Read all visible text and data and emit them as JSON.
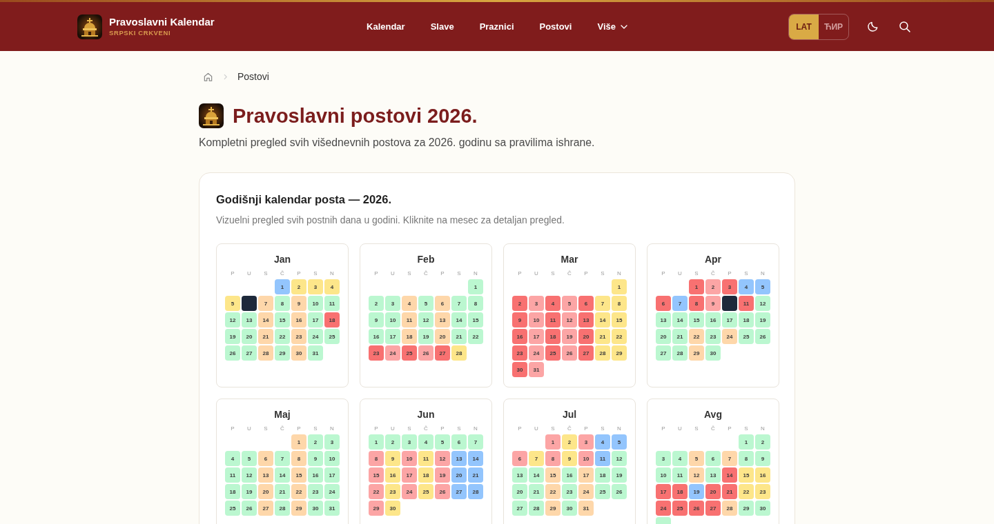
{
  "header": {
    "brand": {
      "title": "Pravoslavni Kalendar",
      "subtitle": "SRPSKI CRKVENI"
    },
    "nav": [
      {
        "label": "Kalendar",
        "kind": "link"
      },
      {
        "label": "Slave",
        "kind": "link"
      },
      {
        "label": "Praznici",
        "kind": "link"
      },
      {
        "label": "Postovi",
        "kind": "link"
      },
      {
        "label": "Više",
        "kind": "menu"
      }
    ],
    "language_toggle": [
      {
        "label": "LAT",
        "selected": true
      },
      {
        "label": "ЋИР",
        "selected": false
      }
    ]
  },
  "breadcrumb": {
    "current": "Postovi"
  },
  "page": {
    "title": "Pravoslavni postovi 2026.",
    "description": "Kompletni pregled svih višednevnih postova za 2026. godinu sa pravilima ishrane."
  },
  "calendar": {
    "title": "Godišnji kalendar posta — 2026.",
    "description": "Vizuelni pregled svih postnih dana u godini. Kliknite na mesec za detaljan pregled.",
    "months": [
      {
        "name": "Jan",
        "weekdays": [
          "P",
          "U",
          "S",
          "Č",
          "P",
          "S",
          "N"
        ],
        "cells": [
          {
            "kind": "blank"
          },
          {
            "kind": "blank"
          },
          {
            "kind": "blank"
          },
          {
            "kind": "day",
            "number": "1",
            "color": "#93c5fd"
          },
          {
            "kind": "day",
            "number": "2",
            "color": "#fde68a"
          },
          {
            "kind": "day",
            "number": "3",
            "color": "#fde68a"
          },
          {
            "kind": "day",
            "number": "4",
            "color": "#fde68a"
          },
          {
            "kind": "day",
            "number": "5",
            "color": "#fde68a"
          },
          {
            "kind": "day",
            "color": "#1e293b"
          },
          {
            "kind": "day",
            "number": "7",
            "color": "#fed7aa"
          },
          {
            "kind": "day",
            "number": "8",
            "color": "#bbf7d0"
          },
          {
            "kind": "day",
            "number": "9",
            "color": "#fed7aa"
          },
          {
            "kind": "day",
            "number": "10",
            "color": "#bbf7d0"
          },
          {
            "kind": "day",
            "number": "11",
            "color": "#bbf7d0"
          },
          {
            "kind": "day",
            "number": "12",
            "color": "#bbf7d0"
          },
          {
            "kind": "day",
            "number": "13",
            "color": "#bbf7d0"
          },
          {
            "kind": "day",
            "number": "14",
            "color": "#fed7aa"
          },
          {
            "kind": "day",
            "number": "15",
            "color": "#bbf7d0"
          },
          {
            "kind": "day",
            "number": "16",
            "color": "#fed7aa"
          },
          {
            "kind": "day",
            "number": "17",
            "color": "#bbf7d0"
          },
          {
            "kind": "day",
            "number": "18",
            "color": "#f87171"
          },
          {
            "kind": "day",
            "number": "19",
            "color": "#bbf7d0"
          },
          {
            "kind": "day",
            "number": "20",
            "color": "#bbf7d0"
          },
          {
            "kind": "day",
            "number": "21",
            "color": "#fed7aa"
          },
          {
            "kind": "day",
            "number": "22",
            "color": "#bbf7d0"
          },
          {
            "kind": "day",
            "number": "23",
            "color": "#fed7aa"
          },
          {
            "kind": "day",
            "number": "24",
            "color": "#bbf7d0"
          },
          {
            "kind": "day",
            "number": "25",
            "color": "#bbf7d0"
          },
          {
            "kind": "day",
            "number": "26",
            "color": "#bbf7d0"
          },
          {
            "kind": "day",
            "number": "27",
            "color": "#bbf7d0"
          },
          {
            "kind": "day",
            "number": "28",
            "color": "#fed7aa"
          },
          {
            "kind": "day",
            "number": "29",
            "color": "#bbf7d0"
          },
          {
            "kind": "day",
            "number": "30",
            "color": "#fed7aa"
          },
          {
            "kind": "day",
            "number": "31",
            "color": "#bbf7d0"
          }
        ]
      },
      {
        "name": "Feb",
        "weekdays": [
          "P",
          "U",
          "S",
          "Č",
          "P",
          "S",
          "N"
        ],
        "cells": [
          {
            "kind": "blank"
          },
          {
            "kind": "blank"
          },
          {
            "kind": "blank"
          },
          {
            "kind": "blank"
          },
          {
            "kind": "blank"
          },
          {
            "kind": "blank"
          },
          {
            "kind": "day",
            "number": "1",
            "color": "#bbf7d0"
          },
          {
            "kind": "day",
            "number": "2",
            "color": "#bbf7d0"
          },
          {
            "kind": "day",
            "number": "3",
            "color": "#bbf7d0"
          },
          {
            "kind": "day",
            "number": "4",
            "color": "#fed7aa"
          },
          {
            "kind": "day",
            "number": "5",
            "color": "#bbf7d0"
          },
          {
            "kind": "day",
            "number": "6",
            "color": "#fed7aa"
          },
          {
            "kind": "day",
            "number": "7",
            "color": "#bbf7d0"
          },
          {
            "kind": "day",
            "number": "8",
            "color": "#bbf7d0"
          },
          {
            "kind": "day",
            "number": "9",
            "color": "#bbf7d0"
          },
          {
            "kind": "day",
            "number": "10",
            "color": "#bbf7d0"
          },
          {
            "kind": "day",
            "number": "11",
            "color": "#fed7aa"
          },
          {
            "kind": "day",
            "number": "12",
            "color": "#bbf7d0"
          },
          {
            "kind": "day",
            "number": "13",
            "color": "#fed7aa"
          },
          {
            "kind": "day",
            "number": "14",
            "color": "#bbf7d0"
          },
          {
            "kind": "day",
            "number": "15",
            "color": "#bbf7d0"
          },
          {
            "kind": "day",
            "number": "16",
            "color": "#bbf7d0"
          },
          {
            "kind": "day",
            "number": "17",
            "color": "#bbf7d0"
          },
          {
            "kind": "day",
            "number": "18",
            "color": "#fed7aa"
          },
          {
            "kind": "day",
            "number": "19",
            "color": "#bbf7d0"
          },
          {
            "kind": "day",
            "number": "20",
            "color": "#fed7aa"
          },
          {
            "kind": "day",
            "number": "21",
            "color": "#bbf7d0"
          },
          {
            "kind": "day",
            "number": "22",
            "color": "#bbf7d0"
          },
          {
            "kind": "day",
            "number": "23",
            "color": "#f87171"
          },
          {
            "kind": "day",
            "number": "24",
            "color": "#fca5a5"
          },
          {
            "kind": "day",
            "number": "25",
            "color": "#f87171"
          },
          {
            "kind": "day",
            "number": "26",
            "color": "#fca5a5"
          },
          {
            "kind": "day",
            "number": "27",
            "color": "#f87171"
          },
          {
            "kind": "day",
            "number": "28",
            "color": "#fde68a"
          }
        ]
      },
      {
        "name": "Mar",
        "weekdays": [
          "P",
          "U",
          "S",
          "Č",
          "P",
          "S",
          "N"
        ],
        "cells": [
          {
            "kind": "blank"
          },
          {
            "kind": "blank"
          },
          {
            "kind": "blank"
          },
          {
            "kind": "blank"
          },
          {
            "kind": "blank"
          },
          {
            "kind": "blank"
          },
          {
            "kind": "day",
            "number": "1",
            "color": "#fde68a"
          },
          {
            "kind": "day",
            "number": "2",
            "color": "#f87171"
          },
          {
            "kind": "day",
            "number": "3",
            "color": "#fca5a5"
          },
          {
            "kind": "day",
            "number": "4",
            "color": "#f87171"
          },
          {
            "kind": "day",
            "number": "5",
            "color": "#fca5a5"
          },
          {
            "kind": "day",
            "number": "6",
            "color": "#f87171"
          },
          {
            "kind": "day",
            "number": "7",
            "color": "#fde68a"
          },
          {
            "kind": "day",
            "number": "8",
            "color": "#fde68a"
          },
          {
            "kind": "day",
            "number": "9",
            "color": "#f87171"
          },
          {
            "kind": "day",
            "number": "10",
            "color": "#fca5a5"
          },
          {
            "kind": "day",
            "number": "11",
            "color": "#f87171"
          },
          {
            "kind": "day",
            "number": "12",
            "color": "#fca5a5"
          },
          {
            "kind": "day",
            "number": "13",
            "color": "#f87171"
          },
          {
            "kind": "day",
            "number": "14",
            "color": "#fde68a"
          },
          {
            "kind": "day",
            "number": "15",
            "color": "#fde68a"
          },
          {
            "kind": "day",
            "number": "16",
            "color": "#f87171"
          },
          {
            "kind": "day",
            "number": "17",
            "color": "#fca5a5"
          },
          {
            "kind": "day",
            "number": "18",
            "color": "#f87171"
          },
          {
            "kind": "day",
            "number": "19",
            "color": "#fca5a5"
          },
          {
            "kind": "day",
            "number": "20",
            "color": "#f87171"
          },
          {
            "kind": "day",
            "number": "21",
            "color": "#fde68a"
          },
          {
            "kind": "day",
            "number": "22",
            "color": "#fde68a"
          },
          {
            "kind": "day",
            "number": "23",
            "color": "#f87171"
          },
          {
            "kind": "day",
            "number": "24",
            "color": "#fca5a5"
          },
          {
            "kind": "day",
            "number": "25",
            "color": "#f87171"
          },
          {
            "kind": "day",
            "number": "26",
            "color": "#fca5a5"
          },
          {
            "kind": "day",
            "number": "27",
            "color": "#f87171"
          },
          {
            "kind": "day",
            "number": "28",
            "color": "#fde68a"
          },
          {
            "kind": "day",
            "number": "29",
            "color": "#fde68a"
          },
          {
            "kind": "day",
            "number": "30",
            "color": "#f87171"
          },
          {
            "kind": "day",
            "number": "31",
            "color": "#fca5a5"
          }
        ]
      },
      {
        "name": "Apr",
        "weekdays": [
          "P",
          "U",
          "S",
          "Č",
          "P",
          "S",
          "N"
        ],
        "cells": [
          {
            "kind": "blank"
          },
          {
            "kind": "blank"
          },
          {
            "kind": "day",
            "number": "1",
            "color": "#f87171"
          },
          {
            "kind": "day",
            "number": "2",
            "color": "#fca5a5"
          },
          {
            "kind": "day",
            "number": "3",
            "color": "#f87171"
          },
          {
            "kind": "day",
            "number": "4",
            "color": "#93c5fd"
          },
          {
            "kind": "day",
            "number": "5",
            "color": "#93c5fd"
          },
          {
            "kind": "day",
            "number": "6",
            "color": "#f87171"
          },
          {
            "kind": "day",
            "number": "7",
            "color": "#93c5fd"
          },
          {
            "kind": "day",
            "number": "8",
            "color": "#f87171"
          },
          {
            "kind": "day",
            "number": "9",
            "color": "#fca5a5"
          },
          {
            "kind": "day",
            "color": "#1e293b"
          },
          {
            "kind": "day",
            "number": "11",
            "color": "#f87171"
          },
          {
            "kind": "day",
            "number": "12",
            "color": "#bbf7d0"
          },
          {
            "kind": "day",
            "number": "13",
            "color": "#bbf7d0"
          },
          {
            "kind": "day",
            "number": "14",
            "color": "#bbf7d0"
          },
          {
            "kind": "day",
            "number": "15",
            "color": "#bbf7d0"
          },
          {
            "kind": "day",
            "number": "16",
            "color": "#bbf7d0"
          },
          {
            "kind": "day",
            "number": "17",
            "color": "#bbf7d0"
          },
          {
            "kind": "day",
            "number": "18",
            "color": "#bbf7d0"
          },
          {
            "kind": "day",
            "number": "19",
            "color": "#bbf7d0"
          },
          {
            "kind": "day",
            "number": "20",
            "color": "#bbf7d0"
          },
          {
            "kind": "day",
            "number": "21",
            "color": "#bbf7d0"
          },
          {
            "kind": "day",
            "number": "22",
            "color": "#fed7aa"
          },
          {
            "kind": "day",
            "number": "23",
            "color": "#bbf7d0"
          },
          {
            "kind": "day",
            "number": "24",
            "color": "#fed7aa"
          },
          {
            "kind": "day",
            "number": "25",
            "color": "#bbf7d0"
          },
          {
            "kind": "day",
            "number": "26",
            "color": "#bbf7d0"
          },
          {
            "kind": "day",
            "number": "27",
            "color": "#bbf7d0"
          },
          {
            "kind": "day",
            "number": "28",
            "color": "#bbf7d0"
          },
          {
            "kind": "day",
            "number": "29",
            "color": "#fed7aa"
          },
          {
            "kind": "day",
            "number": "30",
            "color": "#bbf7d0"
          }
        ]
      },
      {
        "name": "Maj",
        "weekdays": [
          "P",
          "U",
          "S",
          "Č",
          "P",
          "S",
          "N"
        ],
        "cells": [
          {
            "kind": "blank"
          },
          {
            "kind": "blank"
          },
          {
            "kind": "blank"
          },
          {
            "kind": "blank"
          },
          {
            "kind": "day",
            "number": "1",
            "color": "#fed7aa"
          },
          {
            "kind": "day",
            "number": "2",
            "color": "#bbf7d0"
          },
          {
            "kind": "day",
            "number": "3",
            "color": "#bbf7d0"
          },
          {
            "kind": "day",
            "number": "4",
            "color": "#bbf7d0"
          },
          {
            "kind": "day",
            "number": "5",
            "color": "#bbf7d0"
          },
          {
            "kind": "day",
            "number": "6",
            "color": "#fed7aa"
          },
          {
            "kind": "day",
            "number": "7",
            "color": "#bbf7d0"
          },
          {
            "kind": "day",
            "number": "8",
            "color": "#fed7aa"
          },
          {
            "kind": "day",
            "number": "9",
            "color": "#bbf7d0"
          },
          {
            "kind": "day",
            "number": "10",
            "color": "#bbf7d0"
          },
          {
            "kind": "day",
            "number": "11",
            "color": "#bbf7d0"
          },
          {
            "kind": "day",
            "number": "12",
            "color": "#bbf7d0"
          },
          {
            "kind": "day",
            "number": "13",
            "color": "#fed7aa"
          },
          {
            "kind": "day",
            "number": "14",
            "color": "#bbf7d0"
          },
          {
            "kind": "day",
            "number": "15",
            "color": "#fed7aa"
          },
          {
            "kind": "day",
            "number": "16",
            "color": "#bbf7d0"
          },
          {
            "kind": "day",
            "number": "17",
            "color": "#bbf7d0"
          },
          {
            "kind": "day",
            "number": "18",
            "color": "#bbf7d0"
          },
          {
            "kind": "day",
            "number": "19",
            "color": "#bbf7d0"
          },
          {
            "kind": "day",
            "number": "20",
            "color": "#fed7aa"
          },
          {
            "kind": "day",
            "number": "21",
            "color": "#bbf7d0"
          },
          {
            "kind": "day",
            "number": "22",
            "color": "#fed7aa"
          },
          {
            "kind": "day",
            "number": "23",
            "color": "#bbf7d0"
          },
          {
            "kind": "day",
            "number": "24",
            "color": "#bbf7d0"
          },
          {
            "kind": "day",
            "number": "25",
            "color": "#bbf7d0"
          },
          {
            "kind": "day",
            "number": "26",
            "color": "#bbf7d0"
          },
          {
            "kind": "day",
            "number": "27",
            "color": "#fed7aa"
          },
          {
            "kind": "day",
            "number": "28",
            "color": "#bbf7d0"
          },
          {
            "kind": "day",
            "number": "29",
            "color": "#fed7aa"
          },
          {
            "kind": "day",
            "number": "30",
            "color": "#bbf7d0"
          },
          {
            "kind": "day",
            "number": "31",
            "color": "#bbf7d0"
          }
        ]
      },
      {
        "name": "Jun",
        "weekdays": [
          "P",
          "U",
          "S",
          "Č",
          "P",
          "S",
          "N"
        ],
        "cells": [
          {
            "kind": "day",
            "number": "1",
            "color": "#bbf7d0"
          },
          {
            "kind": "day",
            "number": "2",
            "color": "#bbf7d0"
          },
          {
            "kind": "day",
            "number": "3",
            "color": "#bbf7d0"
          },
          {
            "kind": "day",
            "number": "4",
            "color": "#bbf7d0"
          },
          {
            "kind": "day",
            "number": "5",
            "color": "#bbf7d0"
          },
          {
            "kind": "day",
            "number": "6",
            "color": "#bbf7d0"
          },
          {
            "kind": "day",
            "number": "7",
            "color": "#bbf7d0"
          },
          {
            "kind": "day",
            "number": "8",
            "color": "#fca5a5"
          },
          {
            "kind": "day",
            "number": "9",
            "color": "#fde68a"
          },
          {
            "kind": "day",
            "number": "10",
            "color": "#fca5a5"
          },
          {
            "kind": "day",
            "number": "11",
            "color": "#fde68a"
          },
          {
            "kind": "day",
            "number": "12",
            "color": "#fca5a5"
          },
          {
            "kind": "day",
            "number": "13",
            "color": "#93c5fd"
          },
          {
            "kind": "day",
            "number": "14",
            "color": "#93c5fd"
          },
          {
            "kind": "day",
            "number": "15",
            "color": "#fca5a5"
          },
          {
            "kind": "day",
            "number": "16",
            "color": "#fde68a"
          },
          {
            "kind": "day",
            "number": "17",
            "color": "#fca5a5"
          },
          {
            "kind": "day",
            "number": "18",
            "color": "#fde68a"
          },
          {
            "kind": "day",
            "number": "19",
            "color": "#fca5a5"
          },
          {
            "kind": "day",
            "number": "20",
            "color": "#93c5fd"
          },
          {
            "kind": "day",
            "number": "21",
            "color": "#93c5fd"
          },
          {
            "kind": "day",
            "number": "22",
            "color": "#fca5a5"
          },
          {
            "kind": "day",
            "number": "23",
            "color": "#fde68a"
          },
          {
            "kind": "day",
            "number": "24",
            "color": "#fca5a5"
          },
          {
            "kind": "day",
            "number": "25",
            "color": "#fde68a"
          },
          {
            "kind": "day",
            "number": "26",
            "color": "#fca5a5"
          },
          {
            "kind": "day",
            "number": "27",
            "color": "#93c5fd"
          },
          {
            "kind": "day",
            "number": "28",
            "color": "#93c5fd"
          },
          {
            "kind": "day",
            "number": "29",
            "color": "#fca5a5"
          },
          {
            "kind": "day",
            "number": "30",
            "color": "#fde68a"
          }
        ]
      },
      {
        "name": "Jul",
        "weekdays": [
          "P",
          "U",
          "S",
          "Č",
          "P",
          "S",
          "N"
        ],
        "cells": [
          {
            "kind": "blank"
          },
          {
            "kind": "blank"
          },
          {
            "kind": "day",
            "number": "1",
            "color": "#fca5a5"
          },
          {
            "kind": "day",
            "number": "2",
            "color": "#fde68a"
          },
          {
            "kind": "day",
            "number": "3",
            "color": "#fca5a5"
          },
          {
            "kind": "day",
            "number": "4",
            "color": "#93c5fd"
          },
          {
            "kind": "day",
            "number": "5",
            "color": "#93c5fd"
          },
          {
            "kind": "day",
            "number": "6",
            "color": "#fca5a5"
          },
          {
            "kind": "day",
            "number": "7",
            "color": "#fde68a"
          },
          {
            "kind": "day",
            "number": "8",
            "color": "#fca5a5"
          },
          {
            "kind": "day",
            "number": "9",
            "color": "#fde68a"
          },
          {
            "kind": "day",
            "number": "10",
            "color": "#fca5a5"
          },
          {
            "kind": "day",
            "number": "11",
            "color": "#93c5fd"
          },
          {
            "kind": "day",
            "number": "12",
            "color": "#bbf7d0"
          },
          {
            "kind": "day",
            "number": "13",
            "color": "#bbf7d0"
          },
          {
            "kind": "day",
            "number": "14",
            "color": "#bbf7d0"
          },
          {
            "kind": "day",
            "number": "15",
            "color": "#fed7aa"
          },
          {
            "kind": "day",
            "number": "16",
            "color": "#bbf7d0"
          },
          {
            "kind": "day",
            "number": "17",
            "color": "#fed7aa"
          },
          {
            "kind": "day",
            "number": "18",
            "color": "#bbf7d0"
          },
          {
            "kind": "day",
            "number": "19",
            "color": "#bbf7d0"
          },
          {
            "kind": "day",
            "number": "20",
            "color": "#bbf7d0"
          },
          {
            "kind": "day",
            "number": "21",
            "color": "#bbf7d0"
          },
          {
            "kind": "day",
            "number": "22",
            "color": "#fed7aa"
          },
          {
            "kind": "day",
            "number": "23",
            "color": "#bbf7d0"
          },
          {
            "kind": "day",
            "number": "24",
            "color": "#fed7aa"
          },
          {
            "kind": "day",
            "number": "25",
            "color": "#bbf7d0"
          },
          {
            "kind": "day",
            "number": "26",
            "color": "#bbf7d0"
          },
          {
            "kind": "day",
            "number": "27",
            "color": "#bbf7d0"
          },
          {
            "kind": "day",
            "number": "28",
            "color": "#bbf7d0"
          },
          {
            "kind": "day",
            "number": "29",
            "color": "#fed7aa"
          },
          {
            "kind": "day",
            "number": "30",
            "color": "#bbf7d0"
          },
          {
            "kind": "day",
            "number": "31",
            "color": "#fed7aa"
          }
        ]
      },
      {
        "name": "Avg",
        "weekdays": [
          "P",
          "U",
          "S",
          "Č",
          "P",
          "S",
          "N"
        ],
        "cells": [
          {
            "kind": "blank"
          },
          {
            "kind": "blank"
          },
          {
            "kind": "blank"
          },
          {
            "kind": "blank"
          },
          {
            "kind": "blank"
          },
          {
            "kind": "day",
            "number": "1",
            "color": "#bbf7d0"
          },
          {
            "kind": "day",
            "number": "2",
            "color": "#bbf7d0"
          },
          {
            "kind": "day",
            "number": "3",
            "color": "#bbf7d0"
          },
          {
            "kind": "day",
            "number": "4",
            "color": "#bbf7d0"
          },
          {
            "kind": "day",
            "number": "5",
            "color": "#fed7aa"
          },
          {
            "kind": "day",
            "number": "6",
            "color": "#bbf7d0"
          },
          {
            "kind": "day",
            "number": "7",
            "color": "#fed7aa"
          },
          {
            "kind": "day",
            "number": "8",
            "color": "#bbf7d0"
          },
          {
            "kind": "day",
            "number": "9",
            "color": "#bbf7d0"
          },
          {
            "kind": "day",
            "number": "10",
            "color": "#bbf7d0"
          },
          {
            "kind": "day",
            "number": "11",
            "color": "#bbf7d0"
          },
          {
            "kind": "day",
            "number": "12",
            "color": "#fed7aa"
          },
          {
            "kind": "day",
            "number": "13",
            "color": "#bbf7d0"
          },
          {
            "kind": "day",
            "number": "14",
            "color": "#f87171"
          },
          {
            "kind": "day",
            "number": "15",
            "color": "#fde68a"
          },
          {
            "kind": "day",
            "number": "16",
            "color": "#fde68a"
          },
          {
            "kind": "day",
            "number": "17",
            "color": "#f87171"
          },
          {
            "kind": "day",
            "number": "18",
            "color": "#f87171"
          },
          {
            "kind": "day",
            "number": "19",
            "color": "#93c5fd"
          },
          {
            "kind": "day",
            "number": "20",
            "color": "#f87171"
          },
          {
            "kind": "day",
            "number": "21",
            "color": "#f87171"
          },
          {
            "kind": "day",
            "number": "22",
            "color": "#fde68a"
          },
          {
            "kind": "day",
            "number": "23",
            "color": "#fde68a"
          },
          {
            "kind": "day",
            "number": "24",
            "color": "#f87171"
          },
          {
            "kind": "day",
            "number": "25",
            "color": "#f87171"
          },
          {
            "kind": "day",
            "number": "26",
            "color": "#f87171"
          },
          {
            "kind": "day",
            "number": "27",
            "color": "#f87171"
          },
          {
            "kind": "day",
            "number": "28",
            "color": "#fed7aa"
          },
          {
            "kind": "day",
            "number": "29",
            "color": "#bbf7d0"
          },
          {
            "kind": "day",
            "number": "30",
            "color": "#bbf7d0"
          },
          {
            "kind": "day",
            "color": "#bbf7d0"
          }
        ]
      }
    ]
  }
}
